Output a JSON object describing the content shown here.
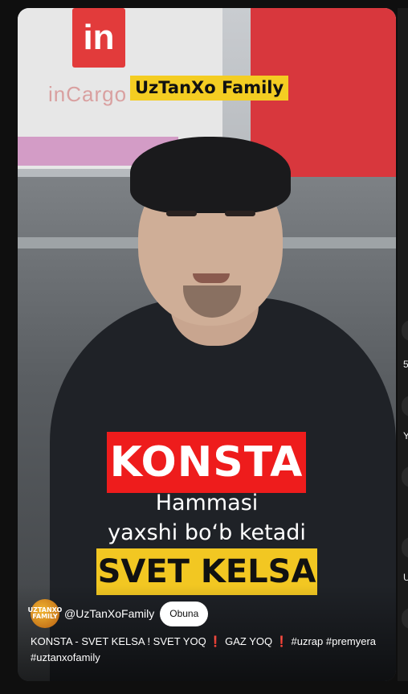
{
  "video": {
    "overlay_brand": "UzTanXo Family",
    "title_red": "KONSTA",
    "subtitle_line1": "Hammasi",
    "subtitle_line2": "yaxshi bo‘b ketadi",
    "title_yellow": "SVET KELSA",
    "billboard_logo": "in",
    "billboard_text": "inCargo"
  },
  "channel": {
    "avatar_text": "UZTANXO FAMILY",
    "handle": "@UzTanXoFamily",
    "subscribe_label": "Obuna"
  },
  "description": {
    "part1": "KONSTA - SVET KELSA ! SVET YOQ ",
    "mark1": "❗",
    "part2": " GAZ YOQ ",
    "mark2": "❗",
    "part3": " ",
    "tag1": "#uzrap",
    "tag2": "#premyera",
    "tag3": "#uztanxofamily"
  },
  "side": {
    "label1": "5",
    "label2": "Y",
    "label3": "U"
  },
  "colors": {
    "accent_red": "#ee1c1c",
    "accent_yellow": "#f2c722",
    "background": "#0f0f0f"
  }
}
